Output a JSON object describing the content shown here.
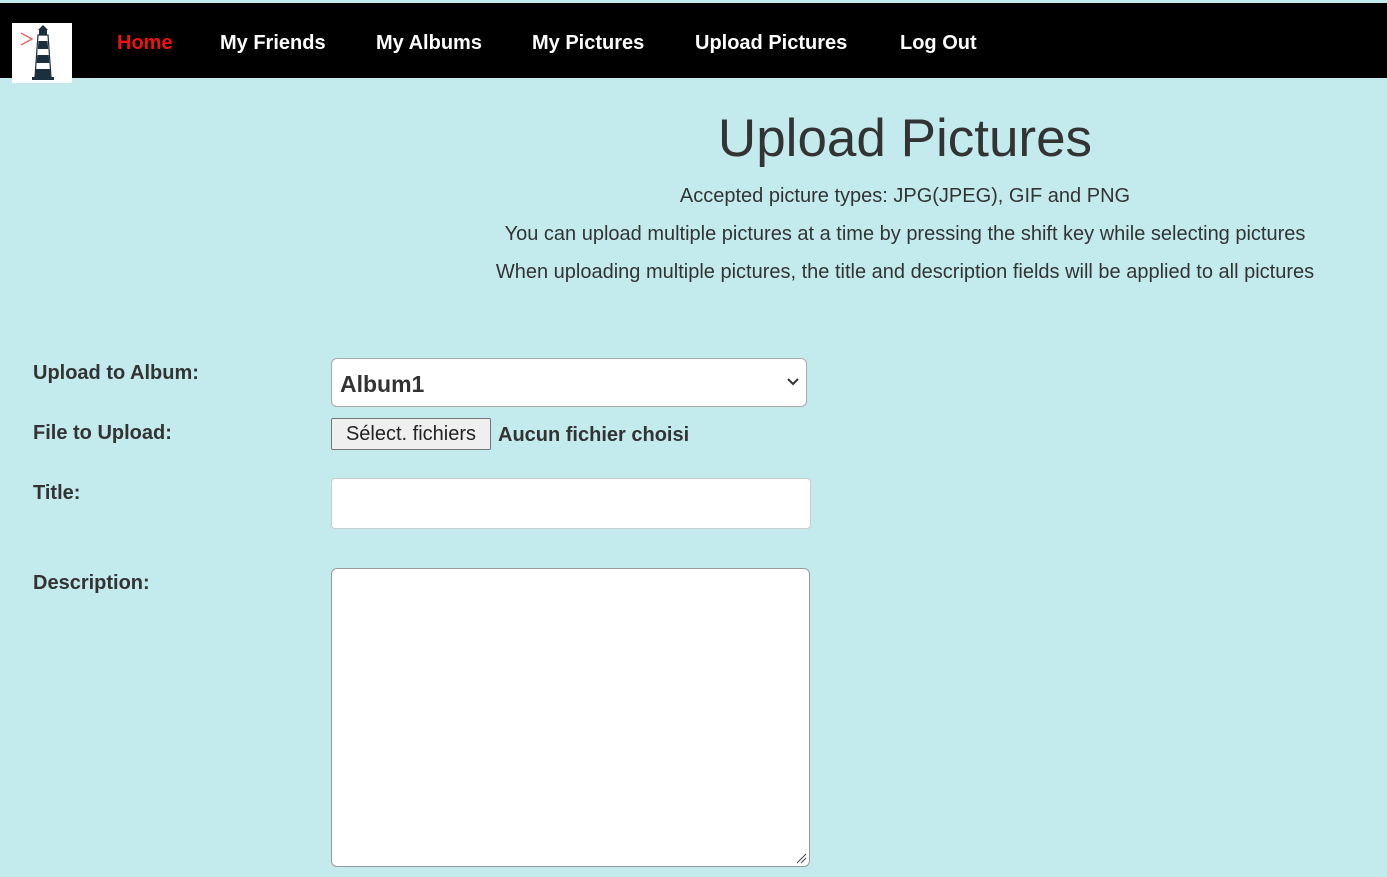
{
  "nav": {
    "logo_icon": "lighthouse-logo-icon",
    "links": [
      {
        "label": "Home",
        "active": true
      },
      {
        "label": "My Friends"
      },
      {
        "label": "My Albums"
      },
      {
        "label": "My Pictures"
      },
      {
        "label": "Upload Pictures"
      },
      {
        "label": "Log Out"
      }
    ]
  },
  "page": {
    "title": "Upload Pictures",
    "info": [
      "Accepted picture types: JPG(JPEG), GIF and PNG",
      "You can upload multiple pictures at a time by pressing the shift key while selecting pictures",
      "When uploading multiple pictures, the title and description fields will be applied to all pictures"
    ]
  },
  "form": {
    "album_label": "Upload to Album:",
    "album_selected": "Album1",
    "file_label": "File to Upload:",
    "file_button": "Sélect. fichiers",
    "file_status": "Aucun fichier choisi",
    "title_label": "Title:",
    "title_value": "",
    "description_label": "Description:",
    "description_value": ""
  },
  "colors": {
    "background": "#c3ebee",
    "navbar": "#000000",
    "nav_text": "#ffffff",
    "nav_active": "#ee1111",
    "text": "#333333"
  }
}
